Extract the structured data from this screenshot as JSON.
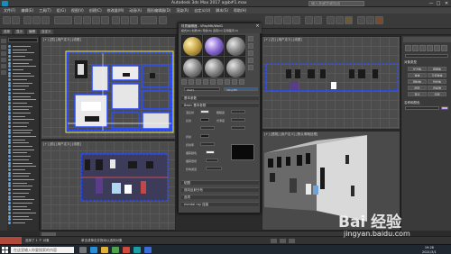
{
  "window": {
    "title": "Autodesk 3ds Max 2017   a@b#1.max",
    "search_placeholder": "键入关键字或短语",
    "controls": [
      "—",
      "□",
      "✕"
    ]
  },
  "menubar": {
    "items": [
      "文件(F)",
      "编辑(E)",
      "工具(T)",
      "组(G)",
      "视图(V)",
      "创建(C)",
      "修改器(M)",
      "动画(A)",
      "图形编辑器(D)",
      "渲染(R)",
      "自定义(U)",
      "脚本(S)",
      "帮助(H)"
    ]
  },
  "ribbon": {
    "tabs": [
      "选择",
      "显示",
      "编辑",
      "自定义"
    ]
  },
  "viewports": {
    "top_label": "[+] [顶] [用户定义] [线框]",
    "left_label": "[+] [前] [用户定义] [线框]",
    "right_top_label": "[+] [左] [用户定义] [线框]",
    "perspective_label": "[+] [透视] [用户定义] [默认明暗处理]"
  },
  "material_editor": {
    "title": "材质编辑器 - VRayMtl/Wall1",
    "menu": "模式(D)  材质(M)  导航(N)  选项(O)  实用程序(U)",
    "material_name": "Wall1",
    "material_type": "VRayMtl",
    "rollouts": {
      "basic": "基本参数",
      "basic_params": "Basic 基本参数",
      "maps": "贴图",
      "brdf": "双向反射分布",
      "options": "选项",
      "mental_ray": "mental ray 连接"
    },
    "labels": {
      "diffuse": "漫反射",
      "roughness": "粗糙度",
      "reflect": "反射",
      "gloss": "光泽度",
      "refract": "折射",
      "ior": "折射率",
      "fog": "烟雾颜色",
      "fog_mult": "烟雾倍增",
      "affect": "影响通道"
    }
  },
  "command_panel": {
    "heading": "对象类型",
    "buttons": [
      "长方体",
      "圆锥体",
      "球体",
      "几何球体",
      "圆柱体",
      "管状体",
      "圆环",
      "四棱锥",
      "茶壶",
      "平面"
    ],
    "name_heading": "名称和颜色"
  },
  "statusbar": {
    "text": "选择了 1 个 对象",
    "hint": "单击或单击并拖动以选择对象"
  },
  "taskbar": {
    "search_placeholder": "在这里输入你要搜索的内容",
    "time": "19:28",
    "date": "2021/3/1"
  },
  "watermark": {
    "logo": "Bai 经验",
    "url": "jingyan.baidu.com"
  },
  "colors": {
    "accent_blue": "#1f4dff",
    "sphere_gold": "#c8a64a",
    "sphere_purple": "#8f6fd6"
  }
}
